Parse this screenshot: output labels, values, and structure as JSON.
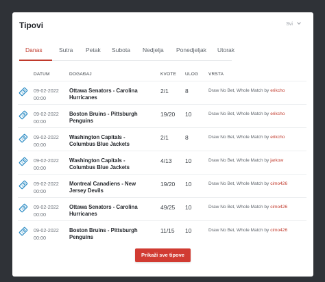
{
  "header": {
    "title": "Tipovi",
    "filter_value": "Svi"
  },
  "tabs": [
    {
      "label": "Danas",
      "active": true
    },
    {
      "label": "Sutra"
    },
    {
      "label": "Petak"
    },
    {
      "label": "Subota"
    },
    {
      "label": "Nedjelja"
    },
    {
      "label": "Ponedjeljak"
    },
    {
      "label": "Utorak"
    }
  ],
  "columns": {
    "date": "DATUM",
    "event": "DOGAĐAJ",
    "odds": "KVOTE",
    "stake": "ULOG",
    "type": "VRSTA"
  },
  "by_word": "by",
  "rows": [
    {
      "date": "09-02-2022",
      "time": "00:00",
      "event": "Ottawa Senators - Carolina Hurricanes",
      "odds": "2/1",
      "stake": "8",
      "type": "Draw No Bet, Whole Match",
      "user": "erikcho"
    },
    {
      "date": "09-02-2022",
      "time": "00:00",
      "event": "Boston Bruins - Pittsburgh Penguins",
      "odds": "19/20",
      "stake": "10",
      "type": "Draw No Bet, Whole Match",
      "user": "erikcho"
    },
    {
      "date": "09-02-2022",
      "time": "00:00",
      "event": "Washington Capitals - Columbus Blue Jackets",
      "odds": "2/1",
      "stake": "8",
      "type": "Draw No Bet, Whole Match",
      "user": "erikcho"
    },
    {
      "date": "09-02-2022",
      "time": "00:00",
      "event": "Washington Capitals - Columbus Blue Jackets",
      "odds": "4/13",
      "stake": "10",
      "type": "Draw No Bet, Whole Match",
      "user": "jarkow"
    },
    {
      "date": "09-02-2022",
      "time": "00:00",
      "event": "Montreal Canadiens - New Jersey Devils",
      "odds": "19/20",
      "stake": "10",
      "type": "Draw No Bet, Whole Match",
      "user": "cimo426"
    },
    {
      "date": "09-02-2022",
      "time": "00:00",
      "event": "Ottawa Senators - Carolina Hurricanes",
      "odds": "49/25",
      "stake": "10",
      "type": "Draw No Bet, Whole Match",
      "user": "cimo426"
    },
    {
      "date": "09-02-2022",
      "time": "00:00",
      "event": "Boston Bruins - Pittsburgh Penguins",
      "odds": "11/15",
      "stake": "10",
      "type": "Draw No Bet, Whole Match",
      "user": "cimo426"
    }
  ],
  "button": {
    "label": "Prikaži sve tipove"
  },
  "colors": {
    "accent": "#c0392b",
    "icon": "#2d8cc4",
    "background": "#2f3237"
  }
}
